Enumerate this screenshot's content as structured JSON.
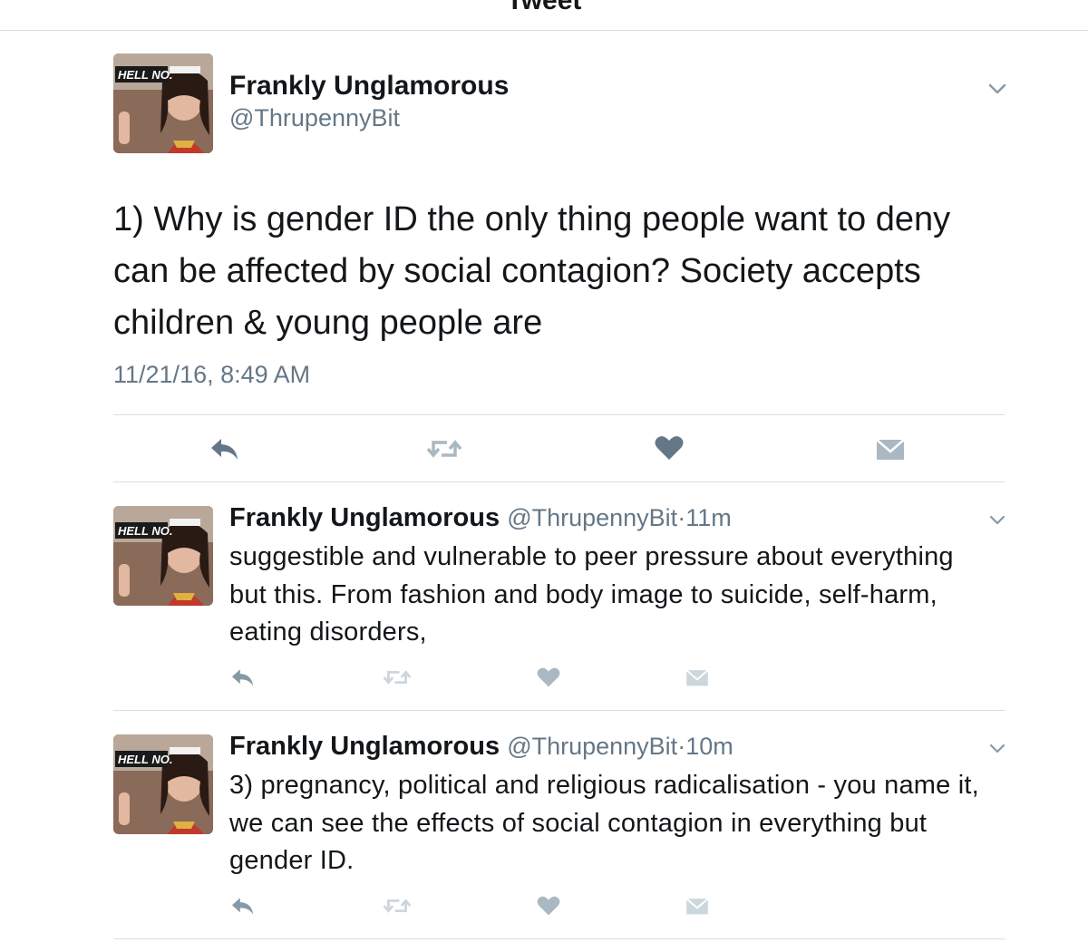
{
  "header": {
    "title": "Tweet"
  },
  "main_tweet": {
    "display_name": "Frankly Unglamorous",
    "handle": "@ThrupennyBit",
    "avatar_text": "HELL NO.",
    "text": "1) Why is gender ID the only thing people want to deny can be affected by social contagion? Society accepts children & young people are",
    "timestamp": "11/21/16, 8:49 AM",
    "actions": [
      "reply-icon",
      "retweet-icon",
      "like-icon",
      "direct-message-icon"
    ]
  },
  "replies": [
    {
      "display_name": "Frankly Unglamorous",
      "handle": "@ThrupennyBit",
      "separator": "·",
      "age": "11m",
      "avatar_text": "HELL NO.",
      "text": "suggestible and vulnerable to peer pressure about everything  but this. From fashion and body image to suicide, self-harm, eating disorders,"
    },
    {
      "display_name": "Frankly Unglamorous",
      "handle": "@ThrupennyBit",
      "separator": "·",
      "age": "10m",
      "avatar_text": "HELL NO.",
      "text": "3) pregnancy, political and religious radicalisation - you name it, we can see the effects of social contagion in everything but gender ID."
    }
  ],
  "colors": {
    "text": "#14171a",
    "secondary": "#657786",
    "divider": "#d8dde2",
    "icon": "#8899a6",
    "icon_dark": "#657786"
  }
}
